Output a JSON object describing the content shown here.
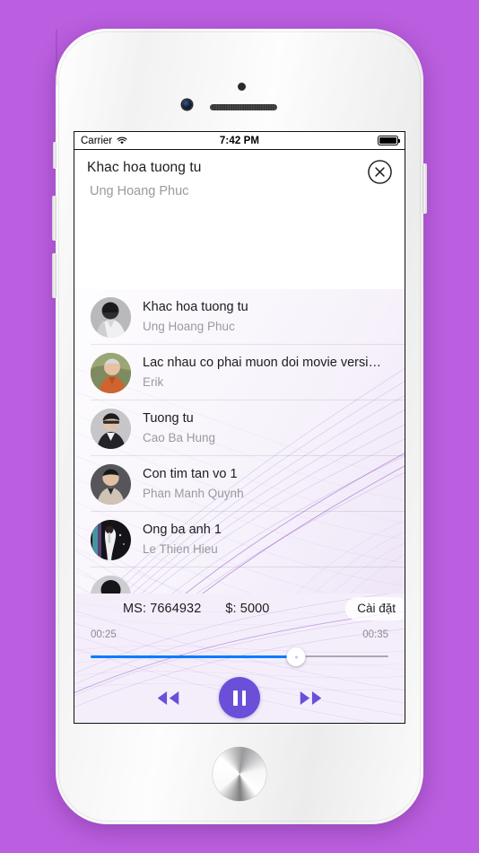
{
  "theme": {
    "page_background": "#BB5FE0",
    "accent_purple": "#6B4FD8",
    "progress_blue": "#0A7CFF",
    "muted_text": "#9A9A9E"
  },
  "status_bar": {
    "carrier": "Carrier",
    "wifi_icon": "wifi-icon",
    "time": "7:42 PM",
    "battery_icon": "battery-full-icon"
  },
  "header": {
    "title": "Khac hoa tuong tu",
    "subtitle": "Ung Hoang Phuc",
    "close_icon": "close-circle-icon"
  },
  "song_list": [
    {
      "title": "Khac hoa tuong tu",
      "artist": "Ung Hoang Phuc"
    },
    {
      "title": "Lac nhau co phai muon doi movie versi…",
      "artist": "Erik"
    },
    {
      "title": "Tuong tu",
      "artist": "Cao Ba Hung"
    },
    {
      "title": "Con tim tan vo 1",
      "artist": "Phan Manh Quynh"
    },
    {
      "title": "Ong ba anh 1",
      "artist": "Le Thien Hieu"
    }
  ],
  "player": {
    "ms_label": "MS: 7664932",
    "price_label": "$: 5000",
    "settings_label": "Cài đặt",
    "elapsed_time": "00:25",
    "total_time": "00:35",
    "progress_percent": 69,
    "rewind_icon": "rewind-icon",
    "pause_icon": "pause-icon",
    "forward_icon": "fast-forward-icon"
  }
}
